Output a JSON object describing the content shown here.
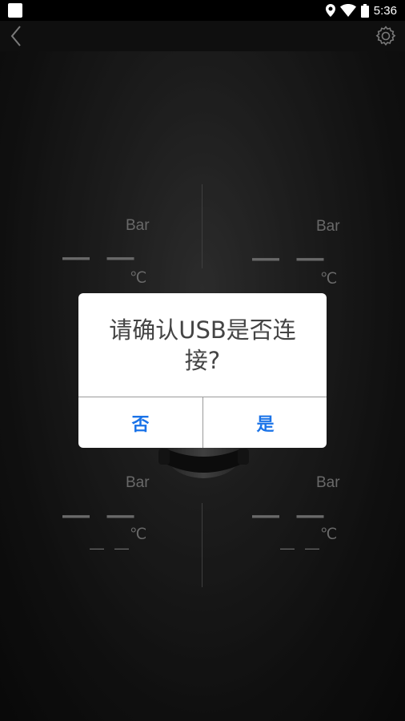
{
  "status_bar": {
    "time": "5:36",
    "icons": [
      "app-notification-icon",
      "location-icon",
      "wifi-icon",
      "battery-icon"
    ]
  },
  "app_bar": {
    "back_icon": "chevron-left-icon",
    "settings_icon": "gear-icon"
  },
  "tires": {
    "front_left": {
      "pressure_unit": "Bar",
      "pressure_value": "— —",
      "temp_unit": "℃"
    },
    "front_right": {
      "pressure_unit": "Bar",
      "pressure_value": "— —",
      "temp_unit": "℃"
    },
    "rear_left": {
      "pressure_unit": "Bar",
      "pressure_value": "— —",
      "temp_value": "— —",
      "temp_unit": "℃"
    },
    "rear_right": {
      "pressure_unit": "Bar",
      "pressure_value": "— —",
      "temp_value": "— —",
      "temp_unit": "℃"
    }
  },
  "dialog": {
    "message": "请确认USB是否连接?",
    "no_label": "否",
    "yes_label": "是",
    "button_color": "#1a73e8"
  }
}
